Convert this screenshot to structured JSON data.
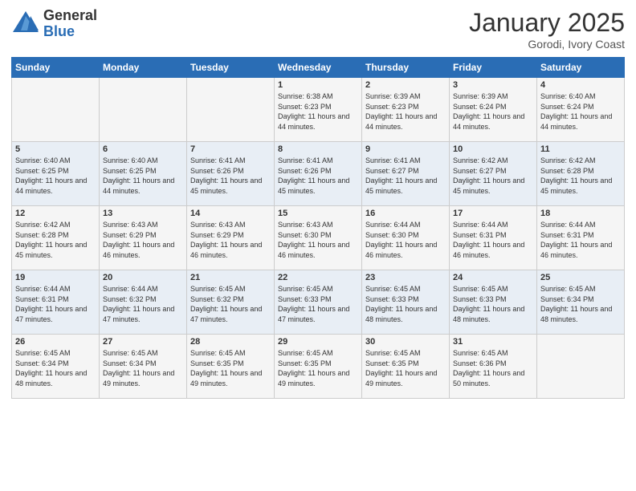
{
  "header": {
    "logo_general": "General",
    "logo_blue": "Blue",
    "title": "January 2025",
    "subtitle": "Gorodi, Ivory Coast"
  },
  "weekdays": [
    "Sunday",
    "Monday",
    "Tuesday",
    "Wednesday",
    "Thursday",
    "Friday",
    "Saturday"
  ],
  "weeks": [
    [
      {
        "day": "",
        "info": ""
      },
      {
        "day": "",
        "info": ""
      },
      {
        "day": "",
        "info": ""
      },
      {
        "day": "1",
        "info": "Sunrise: 6:38 AM\nSunset: 6:23 PM\nDaylight: 11 hours and 44 minutes."
      },
      {
        "day": "2",
        "info": "Sunrise: 6:39 AM\nSunset: 6:23 PM\nDaylight: 11 hours and 44 minutes."
      },
      {
        "day": "3",
        "info": "Sunrise: 6:39 AM\nSunset: 6:24 PM\nDaylight: 11 hours and 44 minutes."
      },
      {
        "day": "4",
        "info": "Sunrise: 6:40 AM\nSunset: 6:24 PM\nDaylight: 11 hours and 44 minutes."
      }
    ],
    [
      {
        "day": "5",
        "info": "Sunrise: 6:40 AM\nSunset: 6:25 PM\nDaylight: 11 hours and 44 minutes."
      },
      {
        "day": "6",
        "info": "Sunrise: 6:40 AM\nSunset: 6:25 PM\nDaylight: 11 hours and 44 minutes."
      },
      {
        "day": "7",
        "info": "Sunrise: 6:41 AM\nSunset: 6:26 PM\nDaylight: 11 hours and 45 minutes."
      },
      {
        "day": "8",
        "info": "Sunrise: 6:41 AM\nSunset: 6:26 PM\nDaylight: 11 hours and 45 minutes."
      },
      {
        "day": "9",
        "info": "Sunrise: 6:41 AM\nSunset: 6:27 PM\nDaylight: 11 hours and 45 minutes."
      },
      {
        "day": "10",
        "info": "Sunrise: 6:42 AM\nSunset: 6:27 PM\nDaylight: 11 hours and 45 minutes."
      },
      {
        "day": "11",
        "info": "Sunrise: 6:42 AM\nSunset: 6:28 PM\nDaylight: 11 hours and 45 minutes."
      }
    ],
    [
      {
        "day": "12",
        "info": "Sunrise: 6:42 AM\nSunset: 6:28 PM\nDaylight: 11 hours and 45 minutes."
      },
      {
        "day": "13",
        "info": "Sunrise: 6:43 AM\nSunset: 6:29 PM\nDaylight: 11 hours and 46 minutes."
      },
      {
        "day": "14",
        "info": "Sunrise: 6:43 AM\nSunset: 6:29 PM\nDaylight: 11 hours and 46 minutes."
      },
      {
        "day": "15",
        "info": "Sunrise: 6:43 AM\nSunset: 6:30 PM\nDaylight: 11 hours and 46 minutes."
      },
      {
        "day": "16",
        "info": "Sunrise: 6:44 AM\nSunset: 6:30 PM\nDaylight: 11 hours and 46 minutes."
      },
      {
        "day": "17",
        "info": "Sunrise: 6:44 AM\nSunset: 6:31 PM\nDaylight: 11 hours and 46 minutes."
      },
      {
        "day": "18",
        "info": "Sunrise: 6:44 AM\nSunset: 6:31 PM\nDaylight: 11 hours and 46 minutes."
      }
    ],
    [
      {
        "day": "19",
        "info": "Sunrise: 6:44 AM\nSunset: 6:31 PM\nDaylight: 11 hours and 47 minutes."
      },
      {
        "day": "20",
        "info": "Sunrise: 6:44 AM\nSunset: 6:32 PM\nDaylight: 11 hours and 47 minutes."
      },
      {
        "day": "21",
        "info": "Sunrise: 6:45 AM\nSunset: 6:32 PM\nDaylight: 11 hours and 47 minutes."
      },
      {
        "day": "22",
        "info": "Sunrise: 6:45 AM\nSunset: 6:33 PM\nDaylight: 11 hours and 47 minutes."
      },
      {
        "day": "23",
        "info": "Sunrise: 6:45 AM\nSunset: 6:33 PM\nDaylight: 11 hours and 48 minutes."
      },
      {
        "day": "24",
        "info": "Sunrise: 6:45 AM\nSunset: 6:33 PM\nDaylight: 11 hours and 48 minutes."
      },
      {
        "day": "25",
        "info": "Sunrise: 6:45 AM\nSunset: 6:34 PM\nDaylight: 11 hours and 48 minutes."
      }
    ],
    [
      {
        "day": "26",
        "info": "Sunrise: 6:45 AM\nSunset: 6:34 PM\nDaylight: 11 hours and 48 minutes."
      },
      {
        "day": "27",
        "info": "Sunrise: 6:45 AM\nSunset: 6:34 PM\nDaylight: 11 hours and 49 minutes."
      },
      {
        "day": "28",
        "info": "Sunrise: 6:45 AM\nSunset: 6:35 PM\nDaylight: 11 hours and 49 minutes."
      },
      {
        "day": "29",
        "info": "Sunrise: 6:45 AM\nSunset: 6:35 PM\nDaylight: 11 hours and 49 minutes."
      },
      {
        "day": "30",
        "info": "Sunrise: 6:45 AM\nSunset: 6:35 PM\nDaylight: 11 hours and 49 minutes."
      },
      {
        "day": "31",
        "info": "Sunrise: 6:45 AM\nSunset: 6:36 PM\nDaylight: 11 hours and 50 minutes."
      },
      {
        "day": "",
        "info": ""
      }
    ]
  ]
}
